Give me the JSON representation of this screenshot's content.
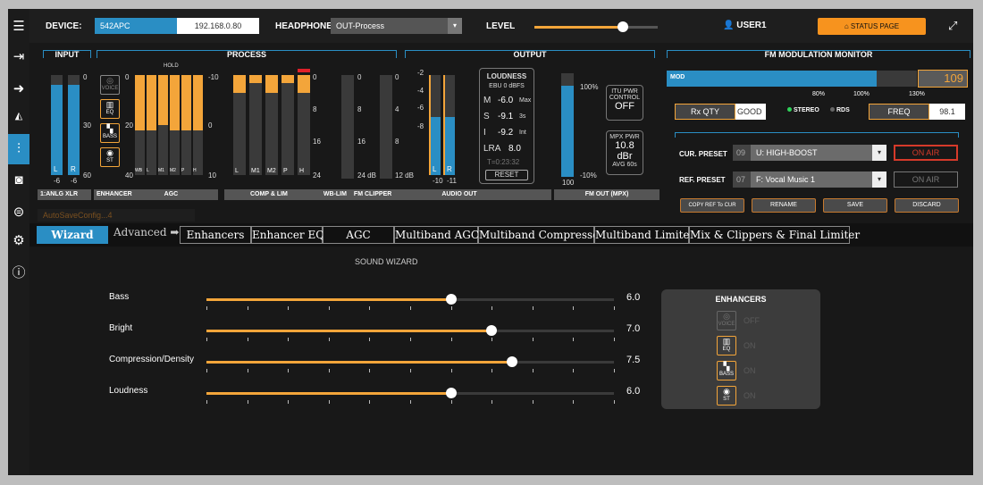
{
  "header": {
    "device_label": "DEVICE:",
    "device_name": "542APC",
    "device_ip": "192.168.0.80",
    "headphone_label": "HEADPHONE",
    "headphone_value": "OUT-Process",
    "level_label": "LEVEL",
    "level_value": 0.72,
    "user": "USER1",
    "status_button": "STATUS PAGE"
  },
  "sections": {
    "input": "INPUT",
    "process": "PROCESS",
    "output": "OUTPUT",
    "fm": "FM MODULATION MONITOR"
  },
  "input": {
    "scale": [
      "0",
      "30",
      "60"
    ],
    "bottom": [
      "-6",
      "-6"
    ],
    "ch": [
      "L",
      "R"
    ],
    "label": "1:ANLG XLR",
    "levels": [
      0.9,
      0.9
    ]
  },
  "process": {
    "hold": "HOLD",
    "icons": [
      "VOICE",
      "EQ",
      "BASS",
      "ST"
    ],
    "agc_scale_left": [
      "0",
      "20",
      "40"
    ],
    "agc_scale_right": [
      "-10",
      "0",
      "10"
    ],
    "agc_bands": [
      "WB",
      "L",
      "M1",
      "M2",
      "P",
      "H"
    ],
    "agc_levels": [
      0.55,
      0.55,
      0.5,
      0.55,
      0.55,
      0.55
    ],
    "comp_bands": [
      "L",
      "M1",
      "M2",
      "P",
      "H"
    ],
    "comp_scale": [
      "0",
      "8",
      "16",
      "24"
    ],
    "wb_scale": [
      "0",
      "8",
      "16",
      "24 dB"
    ],
    "fc_scale": [
      "0",
      "4",
      "8",
      "12 dB"
    ],
    "labels": {
      "enhancer": "ENHANCER",
      "agc": "AGC",
      "comp": "COMP & LIM",
      "wblim": "WB-LIM",
      "fmclip": "FM CLIPPER"
    }
  },
  "output": {
    "scale": [
      "-2",
      "-4",
      "-6",
      "-8"
    ],
    "bottom": [
      "-10",
      "-11"
    ],
    "ch": [
      "L",
      "R"
    ],
    "levels": [
      0.58,
      0.58
    ],
    "loudness": {
      "title": "LOUDNESS",
      "sub": "EBU 0 dBFS",
      "m_label": "M",
      "m_val": "-6.0",
      "m_unit": "Max",
      "s_label": "S",
      "s_val": "-9.1",
      "s_unit": "3s",
      "i_label": "I",
      "i_val": "-9.2",
      "i_unit": "Int",
      "lra_label": "LRA",
      "lra_val": "8.0",
      "time": "T=0:23:32",
      "reset": "RESET"
    },
    "mpx_scale": [
      "100%",
      "-10%"
    ],
    "mpx_bottom": "100",
    "itu": {
      "l1": "ITU PWR",
      "l2": "CONTROL",
      "val": "OFF"
    },
    "mpx": {
      "l1": "MPX PWR",
      "val": "10.8",
      "unit": "dBr",
      "avg": "AVG 60s"
    },
    "labels": {
      "audio_out": "AUDIO OUT",
      "fm_out": "FM OUT (MPX)"
    }
  },
  "fm": {
    "mod_label": "MOD",
    "mod_level": 0.84,
    "mod_value": "109",
    "scale": [
      "80%",
      "100%",
      "130%"
    ],
    "rxqty_label": "Rx QTY",
    "rxqty_value": "GOOD",
    "stereo": "STEREO",
    "rds": "RDS",
    "freq_label": "FREQ",
    "freq_value": "98.1",
    "cur_preset_label": "CUR. PRESET",
    "cur_preset_num": "09",
    "cur_preset": "U: HIGH-BOOST",
    "cur_onair": "ON AIR",
    "ref_preset_label": "REF. PRESET",
    "ref_preset_num": "07",
    "ref_preset": "F: Vocal Music 1",
    "ref_onair": "ON AIR",
    "buttons": [
      "COPY REF To CUR",
      "RENAME",
      "SAVE",
      "DISCARD"
    ],
    "stereo_color": "#2fd35a",
    "rds_color": "#666666"
  },
  "autosave": "AutoSaveConfig...4",
  "tabs": [
    "Wizard",
    "Advanced",
    "Enhancers",
    "Enhancer EQ",
    "AGC",
    "Multiband AGC",
    "Multiband Compressor",
    "Multiband Limiter",
    "Mix & Clippers & Final Limiter"
  ],
  "wizard": {
    "title": "SOUND WIZARD",
    "sliders": [
      {
        "label": "Bass",
        "value": "6.0",
        "fraction": 0.6
      },
      {
        "label": "Bright",
        "value": "7.0",
        "fraction": 0.7
      },
      {
        "label": "Compression/Density",
        "value": "7.5",
        "fraction": 0.75
      },
      {
        "label": "Loudness",
        "value": "6.0",
        "fraction": 0.6
      }
    ],
    "enhancers_title": "ENHANCERS",
    "enhancers": [
      {
        "name": "VOICE",
        "state": "OFF"
      },
      {
        "name": "EQ",
        "state": "ON"
      },
      {
        "name": "BASS",
        "state": "ON"
      },
      {
        "name": "ST",
        "state": "ON"
      }
    ]
  },
  "accent": "#f3a53a",
  "blue": "#2a8ec4"
}
